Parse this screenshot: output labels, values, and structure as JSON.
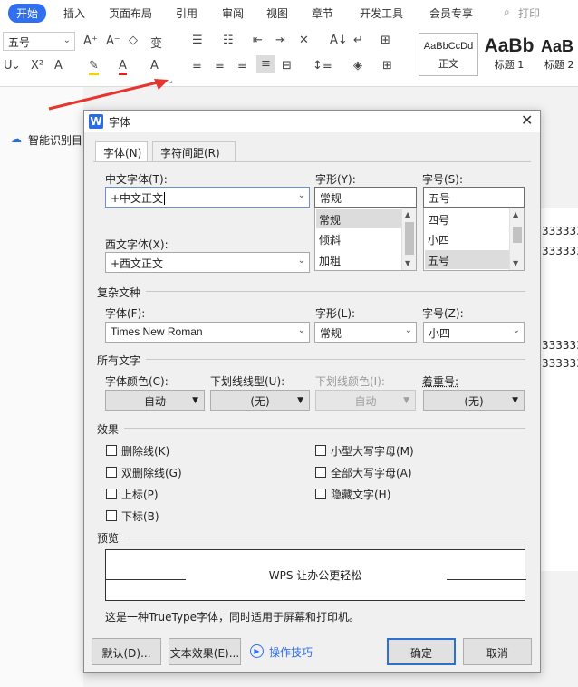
{
  "ribbon": {
    "tabs": [
      {
        "label": "开始"
      },
      {
        "label": "插入"
      },
      {
        "label": "页面布局"
      },
      {
        "label": "引用"
      },
      {
        "label": "审阅"
      },
      {
        "label": "视图"
      },
      {
        "label": "章节"
      },
      {
        "label": "开发工具"
      },
      {
        "label": "会员专享"
      }
    ],
    "print_label": "打印",
    "font_size_value": "五号",
    "styles": [
      {
        "preview": "AaBbCcDd",
        "name": "正文"
      },
      {
        "preview": "AaBb",
        "name": "标题 1"
      },
      {
        "preview": "AaB",
        "name": "标题 2"
      }
    ]
  },
  "sidebar": {
    "smart_recognize": "智能识别目"
  },
  "document": {
    "text_lines": [
      "3333333",
      "3333333",
      "3333333",
      "3333333"
    ]
  },
  "dialog": {
    "title": "字体",
    "tabs": [
      {
        "label": "字体(N)"
      },
      {
        "label": "字符间距(R)"
      }
    ],
    "chinese_font": {
      "label": "中文字体(T):",
      "value": "+中文正文"
    },
    "western_font": {
      "label": "西文字体(X):",
      "value": "+西文正文"
    },
    "style": {
      "label": "字形(Y):",
      "value": "常规",
      "options": [
        "常规",
        "倾斜",
        "加粗"
      ],
      "selected": "常规"
    },
    "size": {
      "label": "字号(S):",
      "value": "五号",
      "options": [
        "四号",
        "小四",
        "五号"
      ],
      "selected": "五号"
    },
    "complex_section": "复杂文种",
    "complex_font": {
      "label": "字体(F):",
      "value": "Times New Roman"
    },
    "complex_style": {
      "label": "字形(L):",
      "value": "常规"
    },
    "complex_size": {
      "label": "字号(Z):",
      "value": "小四"
    },
    "all_text_section": "所有文字",
    "font_color": {
      "label": "字体颜色(C):",
      "value": "自动"
    },
    "underline_type": {
      "label": "下划线线型(U):",
      "value": "(无)"
    },
    "underline_color": {
      "label": "下划线颜色(I):",
      "value": "自动"
    },
    "emphasis": {
      "label": "着重号:",
      "value": "(无)"
    },
    "effects_section": "效果",
    "effects": [
      {
        "label": "删除线(K)",
        "checked": false
      },
      {
        "label": "双删除线(G)",
        "checked": false
      },
      {
        "label": "上标(P)",
        "checked": false
      },
      {
        "label": "下标(B)",
        "checked": false
      },
      {
        "label": "小型大写字母(M)",
        "checked": false
      },
      {
        "label": "全部大写字母(A)",
        "checked": false
      },
      {
        "label": "隐藏文字(H)",
        "checked": false
      }
    ],
    "preview_section": "预览",
    "preview_text": "WPS 让办公更轻松",
    "note": "这是一种TrueType字体，同时适用于屏幕和打印机。",
    "buttons": {
      "default": "默认(D)...",
      "text_effects": "文本效果(E)...",
      "tips": "操作技巧",
      "ok": "确定",
      "cancel": "取消"
    }
  },
  "colors": {
    "accent": "#2f6ff0",
    "arrow": "#e8352c",
    "wps_logo": "#2b6cde"
  }
}
